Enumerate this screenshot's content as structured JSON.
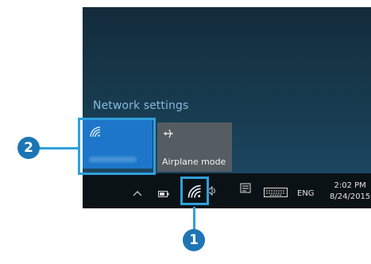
{
  "flyout": {
    "network_settings_label": "Network settings",
    "wifi_tile": {
      "icon": "wifi-icon"
    },
    "airplane_tile": {
      "label": "Airplane mode",
      "icon": "airplane-icon"
    }
  },
  "taskbar": {
    "language": "ENG",
    "time": "2:02 PM",
    "date": "8/24/2015",
    "icons": [
      "chevron-up-icon",
      "battery-icon",
      "wifi-icon",
      "volume-icon",
      "action-center-icon",
      "keyboard-icon"
    ]
  },
  "callouts": {
    "first": "1",
    "second": "2"
  },
  "colors": {
    "accent": "#1d76c9",
    "highlight": "#2fa0dc",
    "badge": "#1d75b5"
  }
}
